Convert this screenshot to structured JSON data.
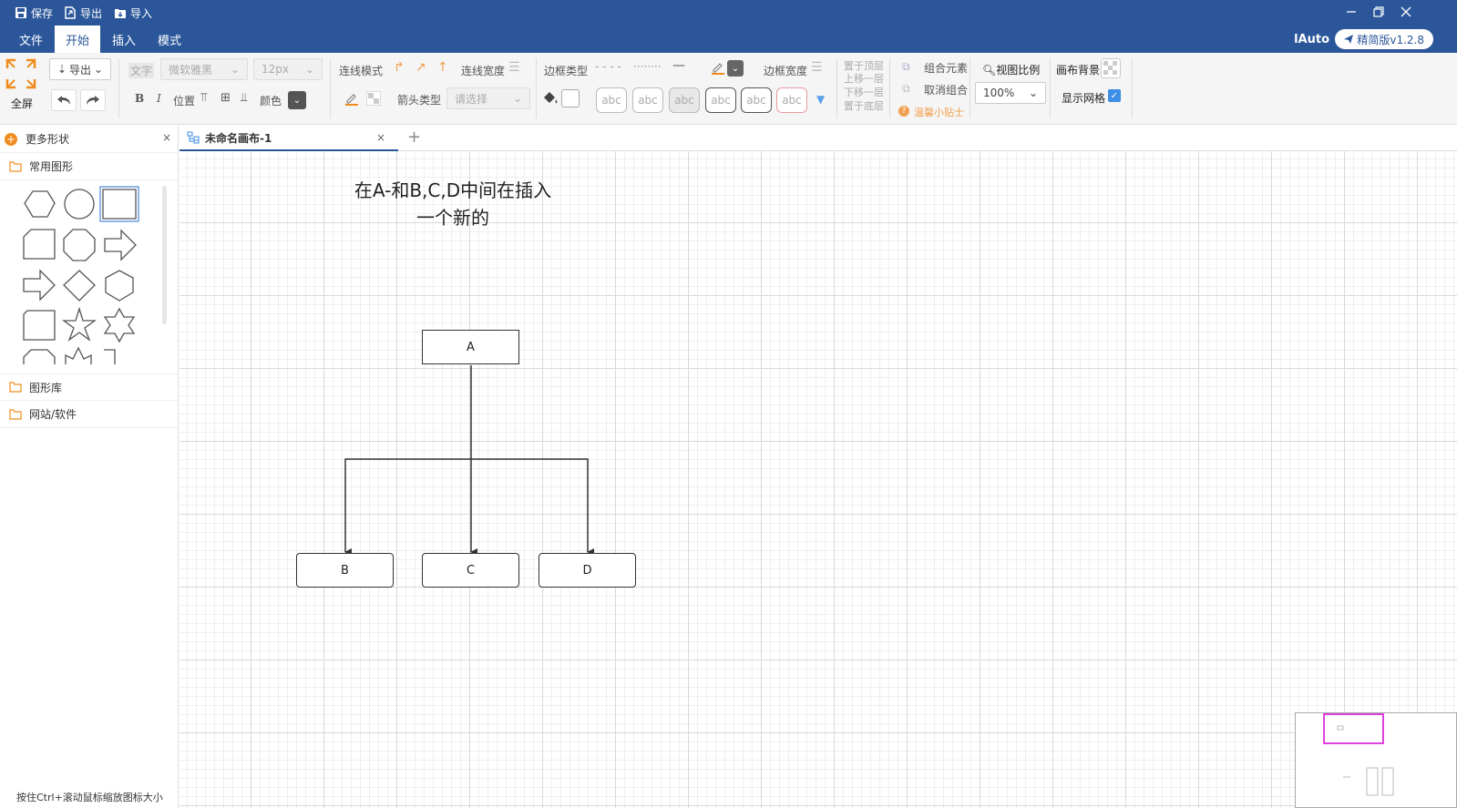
{
  "titlebar": {
    "save": "保存",
    "export": "导出",
    "import": "导入"
  },
  "menubar": {
    "tabs": [
      "文件",
      "开始",
      "插入",
      "模式"
    ],
    "active_tab": "开始",
    "user": "lAuto",
    "version": "精简版v1.2.8"
  },
  "toolbar": {
    "fullscreen": "全屏",
    "export_select": "导出",
    "text_label": "文字",
    "font_family": "微软雅黑",
    "font_size": "12px",
    "bold": "B",
    "italic": "I",
    "position": "位置",
    "color": "颜色",
    "line_mode": "连线模式",
    "line_width": "连线宽度",
    "arrow_type": "箭头类型",
    "arrow_placeholder": "请选择",
    "border_type": "边框类型",
    "border_width": "边框宽度",
    "abc_labels": [
      "abc",
      "abc",
      "abc",
      "abc",
      "abc",
      "abc"
    ],
    "layer_top": "置于顶层",
    "layer_up": "上移一层",
    "layer_down": "下移一层",
    "layer_bottom": "置于底层",
    "group": "组合元素",
    "ungroup": "取消组合",
    "tips": "温馨小贴士",
    "zoom_label": "视图比例",
    "zoom_value": "100%",
    "canvas_bg": "画布背景",
    "show_grid": "显示网格",
    "show_grid_checked": true
  },
  "left_panel": {
    "more_shapes": "更多形状",
    "common_shapes": "常用图形",
    "shape_library": "图形库",
    "web_software": "网站/软件",
    "hint": "按住Ctrl+滚动鼠标缩放图标大小"
  },
  "canvas_tab": {
    "title": "未命名画布-1",
    "close": "×",
    "add": "+"
  },
  "diagram": {
    "note_line1": "在A-和B,C,D中间在插入",
    "note_line2": "一个新的",
    "nodes": {
      "a": "A",
      "b": "B",
      "c": "C",
      "d": "D"
    }
  },
  "colors": {
    "brand": "#2b579a",
    "accent_orange": "#f08c1e",
    "minimap_view": "#e040e0"
  }
}
